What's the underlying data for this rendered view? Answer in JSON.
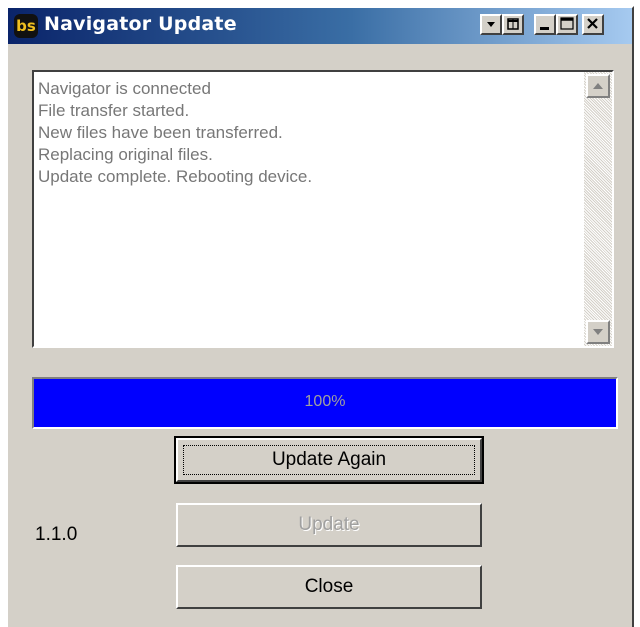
{
  "window": {
    "title": "Navigator Update",
    "icon_text": "bs",
    "caption_buttons": [
      "dropdown-icon",
      "restore-icon",
      "minimize-icon",
      "maximize-icon",
      "close-icon"
    ]
  },
  "log": {
    "lines": [
      "Navigator is connected",
      "File transfer started.",
      "New files have been transferred.",
      "Replacing original files.",
      "Update complete. Rebooting device."
    ]
  },
  "progress": {
    "value": 100,
    "label": "100%",
    "color": "#0000ff"
  },
  "buttons": {
    "update_again": "Update Again",
    "update": "Update",
    "close": "Close"
  },
  "version": "1.1.0",
  "colors": {
    "face": "#d4d0c8",
    "title_start": "#0a246a",
    "title_end": "#a6caf0"
  }
}
